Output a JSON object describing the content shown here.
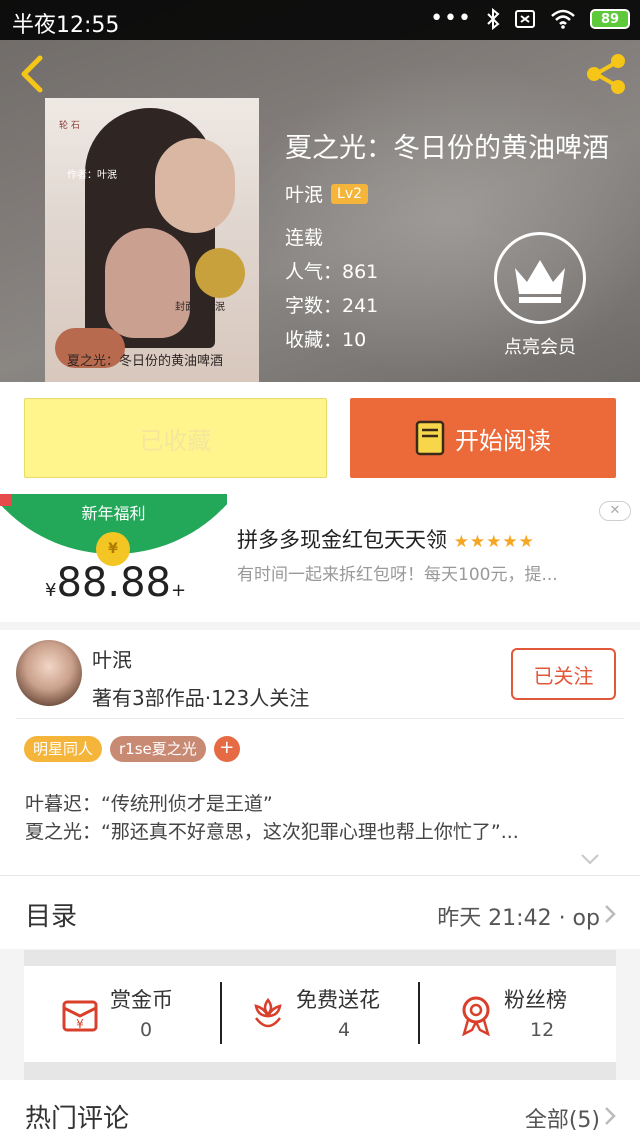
{
  "status_bar": {
    "time": "半夜12:55",
    "dots": "•••",
    "battery": "89"
  },
  "book": {
    "title": "夏之光：冬日份的黄油啤酒",
    "author": "叶泯",
    "level": "Lv2",
    "status": "连载",
    "popularity": "人气：861",
    "word_count": "字数：241",
    "favorites": "收藏：10"
  },
  "cover": {
    "line1": "轮 石",
    "line2": "作者：叶泯",
    "line3": "封面：叶泯",
    "line4": "夏之光：冬日份的黄油啤酒"
  },
  "vip": {
    "label": "点亮会员"
  },
  "actions": {
    "favorited": "已收藏",
    "read": "开始阅读"
  },
  "ad": {
    "banner_title": "新年福利",
    "coin": "¥",
    "currency": "¥",
    "amount": "88.88",
    "amount_suffix": "+",
    "title": "拼多多现金红包天天领",
    "stars": "★★★★★",
    "description": "有时间一起来拆红包呀！每天100元，提...",
    "close": "✕"
  },
  "author_card": {
    "name": "叶泯",
    "stats": "著有3部作品·123人关注",
    "follow_label": "已关注",
    "tags": [
      {
        "label": "明星同人",
        "color": "#f5b43a"
      },
      {
        "label": "r1se夏之光",
        "color": "#c98a74"
      }
    ],
    "tag_add": "+",
    "synopsis": [
      "叶暮迟：“传统刑侦才是王道”",
      "夏之光：“那还真不好意思，这次犯罪心理也帮上你忙了”..."
    ]
  },
  "toc": {
    "label": "目录",
    "update": "昨天 21:42 · op"
  },
  "stats": [
    {
      "label": "赏金币",
      "value": "0",
      "icon": "red-envelope-icon"
    },
    {
      "label": "免费送花",
      "value": "4",
      "icon": "flower-icon"
    },
    {
      "label": "粉丝榜",
      "value": "12",
      "icon": "medal-icon"
    }
  ],
  "comments": {
    "label": "热门评论",
    "all": "全部(5)"
  },
  "colors": {
    "accent": "#ec6a3a",
    "favorite_bg": "#fff58c",
    "follow": "#e2593a",
    "icon_red": "#d9402b"
  }
}
